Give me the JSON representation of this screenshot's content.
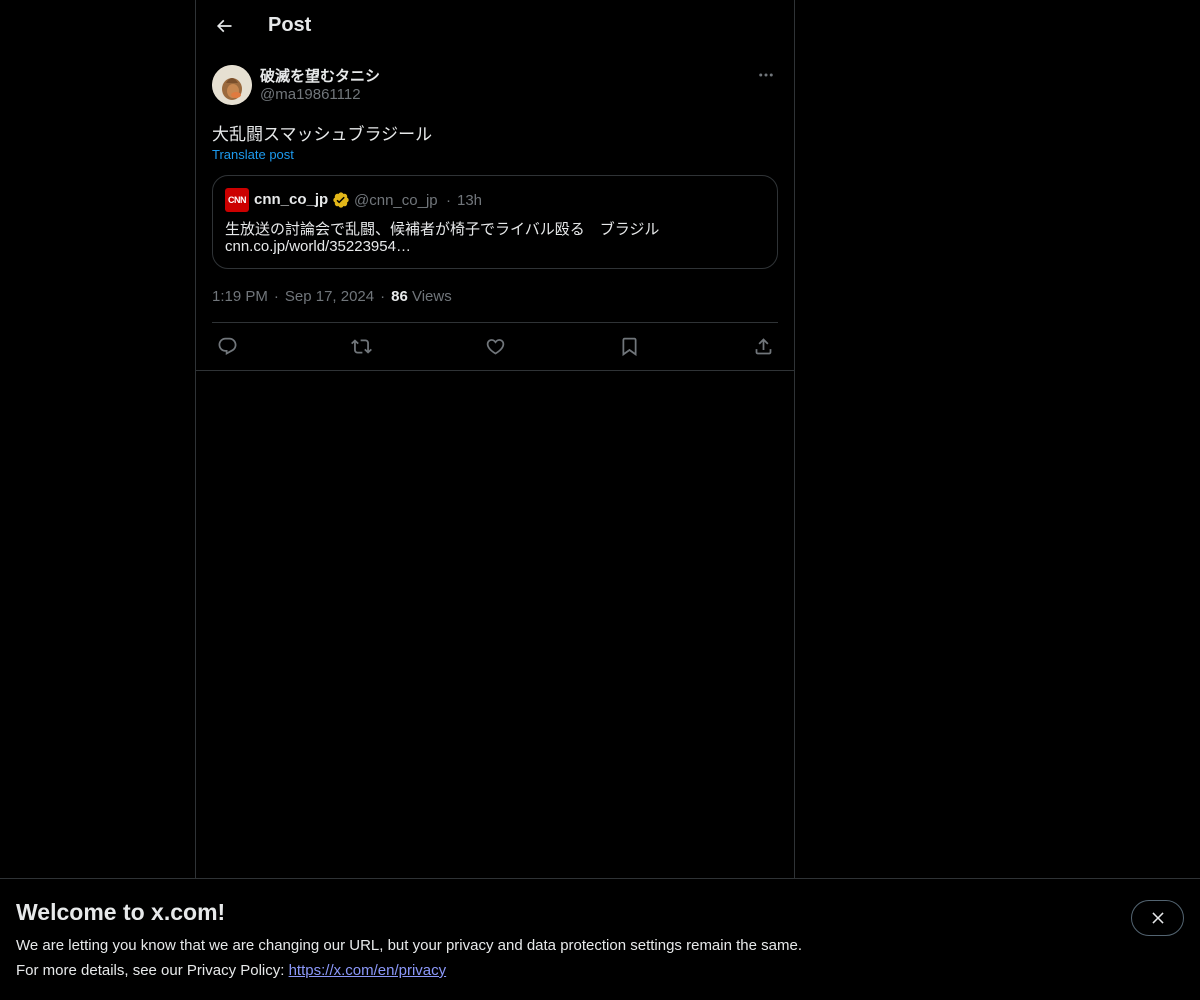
{
  "header": {
    "title": "Post",
    "back_icon": "arrow-left-icon"
  },
  "post": {
    "author_name": "破滅を望むタニシ",
    "author_handle": "@ma19861112",
    "text": "大乱闘スマッシュブラジール",
    "translate_label": "Translate post",
    "quote": {
      "logo_text": "CNN",
      "name": "cnn_co_jp",
      "handle": "@cnn_co_jp",
      "time": "13h",
      "text": "生放送の討論会で乱闘、候補者が椅子でライバル殴る　ブラジル",
      "link": "cnn.co.jp/world/35223954…",
      "verified_color": "#e2b719",
      "logo_color": "#cc0000"
    },
    "time": "1:19 PM",
    "date": "Sep 17, 2024",
    "views_count": "86",
    "views_label": "Views",
    "actions": [
      "reply-icon",
      "repost-icon",
      "like-icon",
      "bookmark-icon",
      "share-icon"
    ]
  },
  "banner": {
    "title": "Welcome to x.com!",
    "line1": "We are letting you know that we are changing our URL, but your privacy and data protection settings remain the same.",
    "line2_prefix": "For more details, see our Privacy Policy: ",
    "link": "https://x.com/en/privacy",
    "close_icon": "close-icon"
  },
  "colors": {
    "background": "#000000",
    "text_primary": "#e7e9ea",
    "text_secondary": "#71767b",
    "accent": "#1d9bf0",
    "border": "#2f3336"
  }
}
